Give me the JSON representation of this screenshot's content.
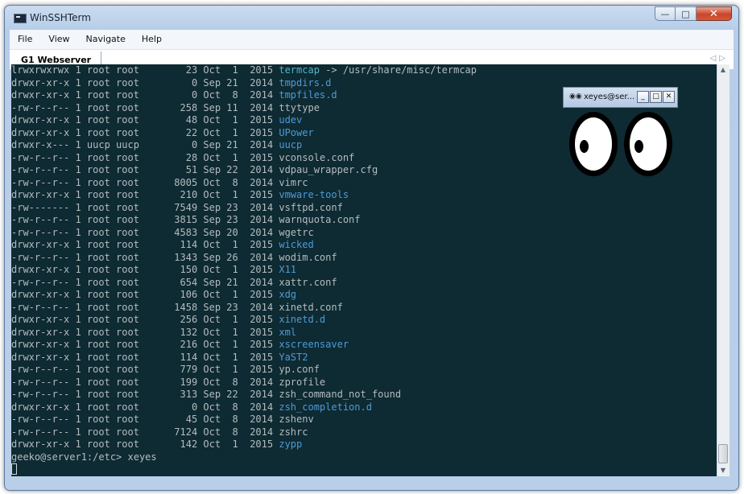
{
  "window": {
    "title": "WinSSHTerm"
  },
  "menu": [
    "File",
    "View",
    "Navigate",
    "Help"
  ],
  "tabs": [
    {
      "label": "G1 Webserver"
    }
  ],
  "terminal": {
    "colors": {
      "bg": "#0e2a32",
      "text": "#b4bcc0",
      "dir": "#4d9bd7",
      "link": "#4fb5c4"
    },
    "listing": [
      {
        "perm": "lrwxrwxrwx",
        "links": "1",
        "owner": "root",
        "group": "root",
        "size": "23",
        "month": "Oct",
        "day": "1",
        "year": "2015",
        "name": "termcap",
        "target": "/usr/share/misc/termcap",
        "kind": "link"
      },
      {
        "perm": "drwxr-xr-x",
        "links": "1",
        "owner": "root",
        "group": "root",
        "size": "0",
        "month": "Sep",
        "day": "21",
        "year": "2014",
        "name": "tmpdirs.d",
        "kind": "dir"
      },
      {
        "perm": "drwxr-xr-x",
        "links": "1",
        "owner": "root",
        "group": "root",
        "size": "0",
        "month": "Oct",
        "day": "8",
        "year": "2014",
        "name": "tmpfiles.d",
        "kind": "dir"
      },
      {
        "perm": "-rw-r--r--",
        "links": "1",
        "owner": "root",
        "group": "root",
        "size": "258",
        "month": "Sep",
        "day": "11",
        "year": "2014",
        "name": "ttytype",
        "kind": "file"
      },
      {
        "perm": "drwxr-xr-x",
        "links": "1",
        "owner": "root",
        "group": "root",
        "size": "48",
        "month": "Oct",
        "day": "1",
        "year": "2015",
        "name": "udev",
        "kind": "dir"
      },
      {
        "perm": "drwxr-xr-x",
        "links": "1",
        "owner": "root",
        "group": "root",
        "size": "22",
        "month": "Oct",
        "day": "1",
        "year": "2015",
        "name": "UPower",
        "kind": "dir"
      },
      {
        "perm": "drwxr-x---",
        "links": "1",
        "owner": "uucp",
        "group": "uucp",
        "size": "0",
        "month": "Sep",
        "day": "21",
        "year": "2014",
        "name": "uucp",
        "kind": "dir"
      },
      {
        "perm": "-rw-r--r--",
        "links": "1",
        "owner": "root",
        "group": "root",
        "size": "28",
        "month": "Oct",
        "day": "1",
        "year": "2015",
        "name": "vconsole.conf",
        "kind": "file"
      },
      {
        "perm": "-rw-r--r--",
        "links": "1",
        "owner": "root",
        "group": "root",
        "size": "51",
        "month": "Sep",
        "day": "22",
        "year": "2014",
        "name": "vdpau_wrapper.cfg",
        "kind": "file"
      },
      {
        "perm": "-rw-r--r--",
        "links": "1",
        "owner": "root",
        "group": "root",
        "size": "8005",
        "month": "Oct",
        "day": "8",
        "year": "2014",
        "name": "vimrc",
        "kind": "file"
      },
      {
        "perm": "drwxr-xr-x",
        "links": "1",
        "owner": "root",
        "group": "root",
        "size": "210",
        "month": "Oct",
        "day": "1",
        "year": "2015",
        "name": "vmware-tools",
        "kind": "dir"
      },
      {
        "perm": "-rw-------",
        "links": "1",
        "owner": "root",
        "group": "root",
        "size": "7549",
        "month": "Sep",
        "day": "23",
        "year": "2014",
        "name": "vsftpd.conf",
        "kind": "file"
      },
      {
        "perm": "-rw-r--r--",
        "links": "1",
        "owner": "root",
        "group": "root",
        "size": "3815",
        "month": "Sep",
        "day": "23",
        "year": "2014",
        "name": "warnquota.conf",
        "kind": "file"
      },
      {
        "perm": "-rw-r--r--",
        "links": "1",
        "owner": "root",
        "group": "root",
        "size": "4583",
        "month": "Sep",
        "day": "20",
        "year": "2014",
        "name": "wgetrc",
        "kind": "file"
      },
      {
        "perm": "drwxr-xr-x",
        "links": "1",
        "owner": "root",
        "group": "root",
        "size": "114",
        "month": "Oct",
        "day": "1",
        "year": "2015",
        "name": "wicked",
        "kind": "dir"
      },
      {
        "perm": "-rw-r--r--",
        "links": "1",
        "owner": "root",
        "group": "root",
        "size": "1343",
        "month": "Sep",
        "day": "26",
        "year": "2014",
        "name": "wodim.conf",
        "kind": "file"
      },
      {
        "perm": "drwxr-xr-x",
        "links": "1",
        "owner": "root",
        "group": "root",
        "size": "150",
        "month": "Oct",
        "day": "1",
        "year": "2015",
        "name": "X11",
        "kind": "dir"
      },
      {
        "perm": "-rw-r--r--",
        "links": "1",
        "owner": "root",
        "group": "root",
        "size": "654",
        "month": "Sep",
        "day": "21",
        "year": "2014",
        "name": "xattr.conf",
        "kind": "file"
      },
      {
        "perm": "drwxr-xr-x",
        "links": "1",
        "owner": "root",
        "group": "root",
        "size": "106",
        "month": "Oct",
        "day": "1",
        "year": "2015",
        "name": "xdg",
        "kind": "dir"
      },
      {
        "perm": "-rw-r--r--",
        "links": "1",
        "owner": "root",
        "group": "root",
        "size": "1458",
        "month": "Sep",
        "day": "23",
        "year": "2014",
        "name": "xinetd.conf",
        "kind": "file"
      },
      {
        "perm": "drwxr-xr-x",
        "links": "1",
        "owner": "root",
        "group": "root",
        "size": "256",
        "month": "Oct",
        "day": "1",
        "year": "2015",
        "name": "xinetd.d",
        "kind": "dir"
      },
      {
        "perm": "drwxr-xr-x",
        "links": "1",
        "owner": "root",
        "group": "root",
        "size": "132",
        "month": "Oct",
        "day": "1",
        "year": "2015",
        "name": "xml",
        "kind": "dir"
      },
      {
        "perm": "drwxr-xr-x",
        "links": "1",
        "owner": "root",
        "group": "root",
        "size": "216",
        "month": "Oct",
        "day": "1",
        "year": "2015",
        "name": "xscreensaver",
        "kind": "dir"
      },
      {
        "perm": "drwxr-xr-x",
        "links": "1",
        "owner": "root",
        "group": "root",
        "size": "114",
        "month": "Oct",
        "day": "1",
        "year": "2015",
        "name": "YaST2",
        "kind": "dir"
      },
      {
        "perm": "-rw-r--r--",
        "links": "1",
        "owner": "root",
        "group": "root",
        "size": "779",
        "month": "Oct",
        "day": "1",
        "year": "2015",
        "name": "yp.conf",
        "kind": "file"
      },
      {
        "perm": "-rw-r--r--",
        "links": "1",
        "owner": "root",
        "group": "root",
        "size": "199",
        "month": "Oct",
        "day": "8",
        "year": "2014",
        "name": "zprofile",
        "kind": "file"
      },
      {
        "perm": "-rw-r--r--",
        "links": "1",
        "owner": "root",
        "group": "root",
        "size": "313",
        "month": "Sep",
        "day": "22",
        "year": "2014",
        "name": "zsh_command_not_found",
        "kind": "file"
      },
      {
        "perm": "drwxr-xr-x",
        "links": "1",
        "owner": "root",
        "group": "root",
        "size": "0",
        "month": "Oct",
        "day": "8",
        "year": "2014",
        "name": "zsh_completion.d",
        "kind": "dir"
      },
      {
        "perm": "-rw-r--r--",
        "links": "1",
        "owner": "root",
        "group": "root",
        "size": "45",
        "month": "Oct",
        "day": "8",
        "year": "2014",
        "name": "zshenv",
        "kind": "file"
      },
      {
        "perm": "-rw-r--r--",
        "links": "1",
        "owner": "root",
        "group": "root",
        "size": "7124",
        "month": "Oct",
        "day": "8",
        "year": "2014",
        "name": "zshrc",
        "kind": "file"
      },
      {
        "perm": "drwxr-xr-x",
        "links": "1",
        "owner": "root",
        "group": "root",
        "size": "142",
        "month": "Oct",
        "day": "1",
        "year": "2015",
        "name": "zypp",
        "kind": "dir"
      }
    ],
    "prompt": "geeko@server1:/etc> xeyes"
  },
  "xeyes": {
    "title": "xeyes@ser...",
    "icon": "eyes-icon"
  }
}
